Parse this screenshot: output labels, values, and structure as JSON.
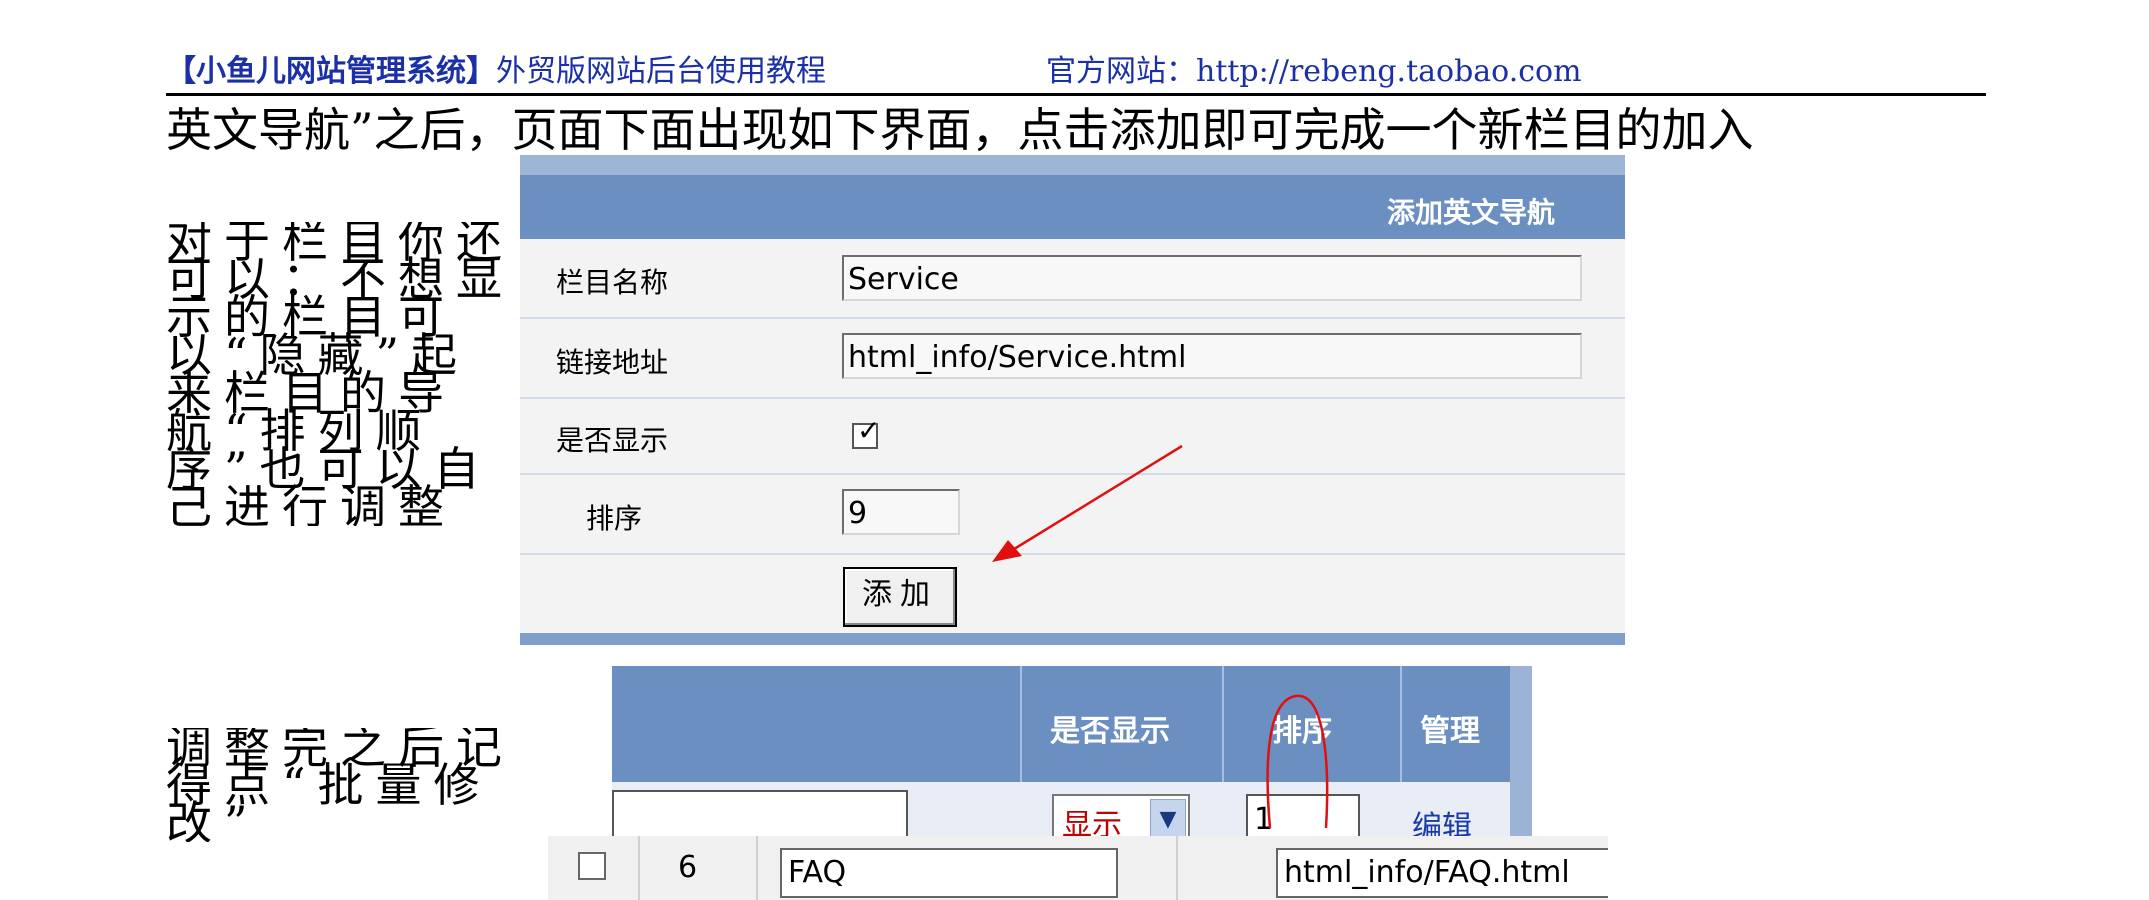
{
  "header": {
    "brand": "【小鱼儿网站管理系统】",
    "subtitle": "外贸版网站后台使用教程",
    "site": "官方网站：http://rebeng.taobao.com"
  },
  "body": {
    "line1": "英文导航”之后，页面下面出现如下界面，点击添加即可完成一个新栏目的加入",
    "para2": "对于栏目你还可以：不想显示的栏目可以“隐藏”起来栏目的导航“排列顺序”也可以自己进行调整",
    "para3": "调整完之后记得点“批量修改”"
  },
  "form": {
    "title": "添加英文导航",
    "fields": [
      {
        "label": "栏目名称",
        "value": "Service"
      },
      {
        "label": "链接地址",
        "value": "html_info/Service.html"
      },
      {
        "label": "是否显示",
        "checked": true
      },
      {
        "label": "排序",
        "value": "9"
      }
    ],
    "submit": "添加"
  },
  "list": {
    "headers": [
      "是否显示",
      "排序",
      "管理"
    ],
    "row": {
      "show": "显示",
      "order": "1",
      "action": "编辑"
    }
  },
  "row3": {
    "id": "6",
    "name": "FAQ",
    "link": "html_info/FAQ.html"
  },
  "colors": {
    "accent": "#1a2fa8",
    "bar": "#6c8fc1",
    "annotation": "#e01010"
  }
}
